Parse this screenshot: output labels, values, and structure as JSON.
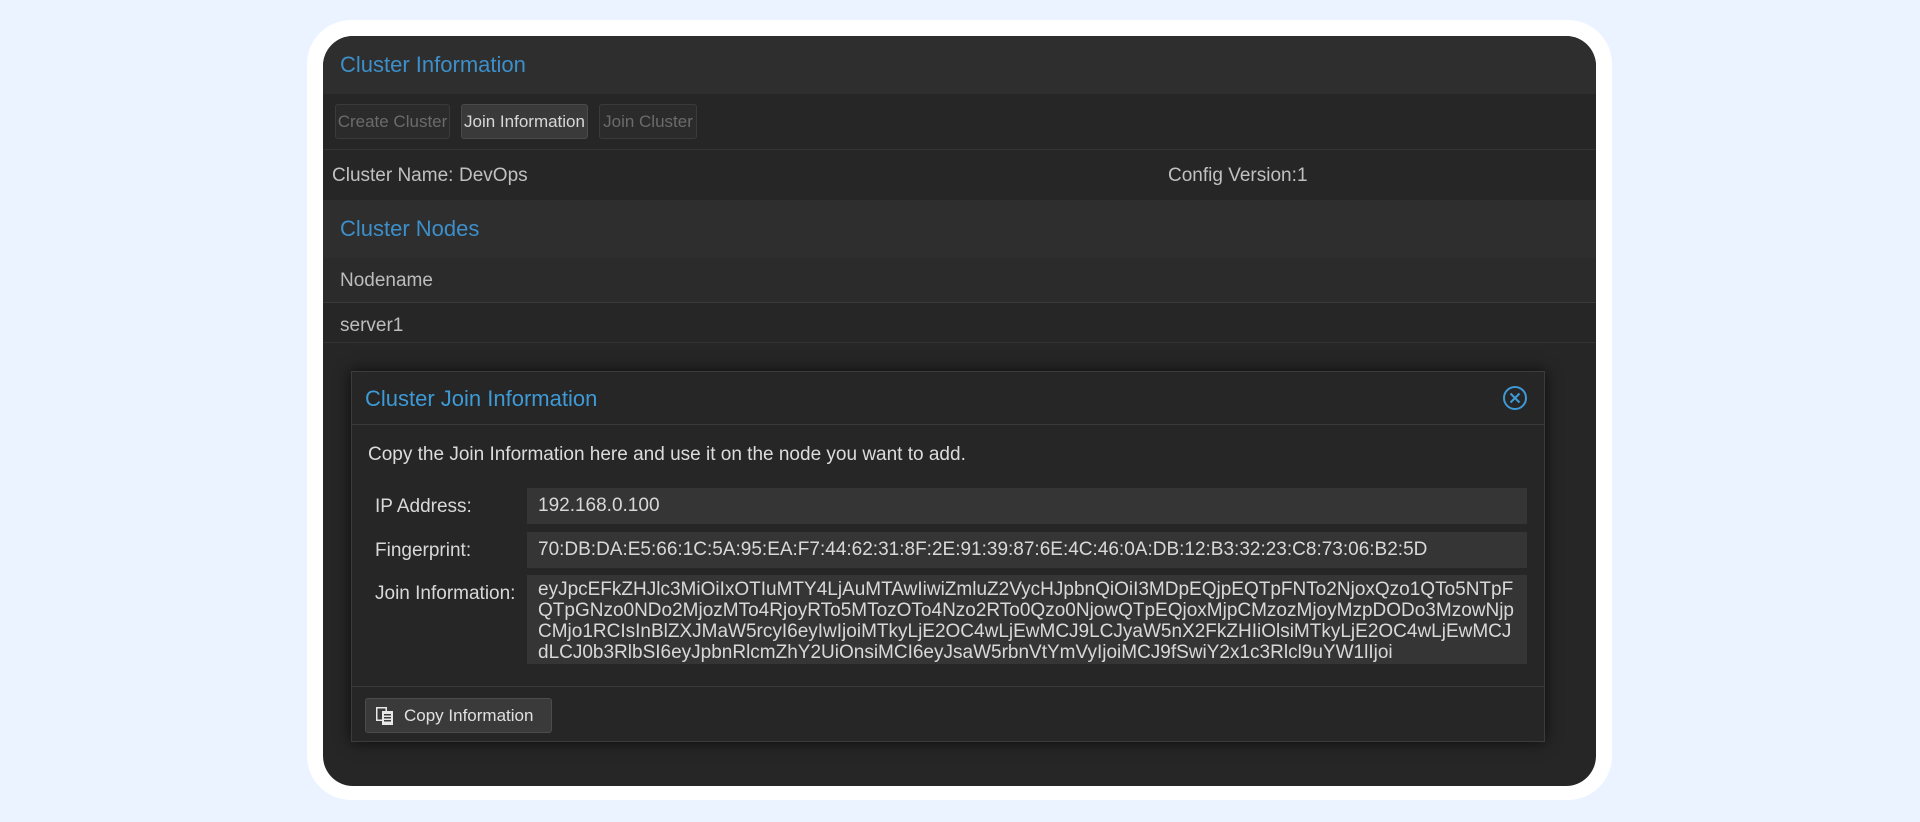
{
  "cluster_panel": {
    "title": "Cluster Information",
    "toolbar": {
      "create_label": "Create Cluster",
      "join_info_label": "Join Information",
      "join_cluster_label": "Join Cluster"
    },
    "cluster_name_label": "Cluster Name:",
    "cluster_name_value": "DevOps",
    "config_version_label": "Config Version:",
    "config_version_value": "1"
  },
  "nodes_panel": {
    "title": "Cluster Nodes",
    "column_header": "Nodename",
    "rows": [
      "server1"
    ]
  },
  "modal": {
    "title": "Cluster Join Information",
    "close_icon": "close-circle-icon",
    "description": "Copy the Join Information here and use it on the node you want to add.",
    "ip_label": "IP Address:",
    "ip_value": "192.168.0.100",
    "fingerprint_label": "Fingerprint:",
    "fingerprint_value": "70:DB:DA:E5:66:1C:5A:95:EA:F7:44:62:31:8F:2E:91:39:87:6E:4C:46:0A:DB:12:B3:32:23:C8:73:06:B2:5D",
    "join_label": "Join Information:",
    "join_value": "eyJpcEFkZHJlc3MiOiIxOTIuMTY4LjAuMTAwIiwiZmluZ2VycHJpbnQiOiI3MDpEQjpEQTpFNTo2NjoxQzo1QTo5NTpFQTpGNzo0NDo2MjozMTo4RjoyRTo5MTozOTo4Nzo2RTo0Qzo0NjowQTpEQjoxMjpCMzozMjoyMzpDODo3MzowNjpCMjo1RCIsInBlZXJMaW5rcyI6eyIwIjoiMTkyLjE2OC4wLjEwMCJ9LCJyaW5nX2FkZHIiOlsiMTkyLjE2OC4wLjEwMCJdLCJ0b3RlbSI6eyJpbnRlcmZhY2UiOnsiMCI6eyJsaW5rbnVtYmVyIjoiMCJ9fSwiY2x1c3Rlcl9uYW1lIjoi",
    "copy_label": "Copy Information",
    "copy_icon": "copy-icon"
  },
  "colors": {
    "accent": "#3d8fc9",
    "background": "#262626"
  }
}
